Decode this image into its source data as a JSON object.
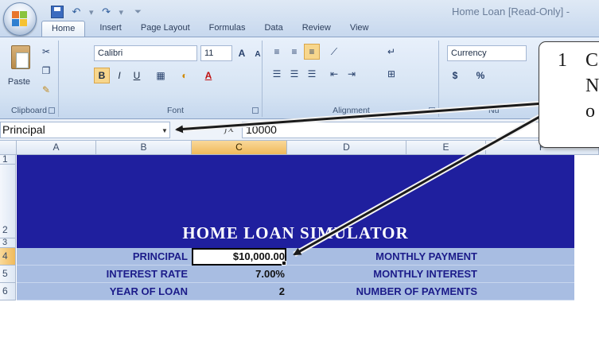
{
  "window": {
    "title": "Home Loan  [Read-Only] -"
  },
  "quick_access": {
    "save_icon": "save-icon",
    "undo_icon": "undo-icon",
    "redo_icon": "redo-icon"
  },
  "tabs": [
    {
      "label": "Home",
      "active": true
    },
    {
      "label": "Insert"
    },
    {
      "label": "Page Layout"
    },
    {
      "label": "Formulas"
    },
    {
      "label": "Data"
    },
    {
      "label": "Review"
    },
    {
      "label": "View"
    }
  ],
  "ribbon": {
    "clipboard": {
      "label": "Clipboard",
      "paste_label": "Paste"
    },
    "font": {
      "label": "Font",
      "font_name": "Calibri",
      "font_size": "11",
      "grow": "A",
      "shrink": "A",
      "bold": "B",
      "italic": "I",
      "underline": "U"
    },
    "alignment": {
      "label": "Alignment"
    },
    "number": {
      "label": "Nu",
      "format": "Currency",
      "currency_symbol": "$",
      "percent_symbol": "%"
    }
  },
  "formula_bar": {
    "name_box": "Principal",
    "fx": "fx",
    "value": "10000"
  },
  "columns": [
    "A",
    "B",
    "C",
    "D",
    "E",
    "F"
  ],
  "rows": [
    "1",
    "2",
    "3",
    "4",
    "5",
    "6"
  ],
  "sheet": {
    "title": "HOME LOAN SIMULATOR",
    "rows": [
      {
        "label": "PRINCIPAL",
        "value": "$10,000.00",
        "label2": "MONTHLY PAYMENT"
      },
      {
        "label": "INTEREST RATE",
        "value": "7.00%",
        "label2": "MONTHLY INTEREST"
      },
      {
        "label": "YEAR OF LOAN",
        "value": "2",
        "label2": "NUMBER OF PAYMENTS"
      }
    ]
  },
  "callout": {
    "step": "1",
    "line1": "C",
    "line2": "N",
    "line3": "o"
  },
  "colors": {
    "banner": "#1f1f9e",
    "band": "#a8bde2",
    "selected_header": "#f0b95a"
  }
}
